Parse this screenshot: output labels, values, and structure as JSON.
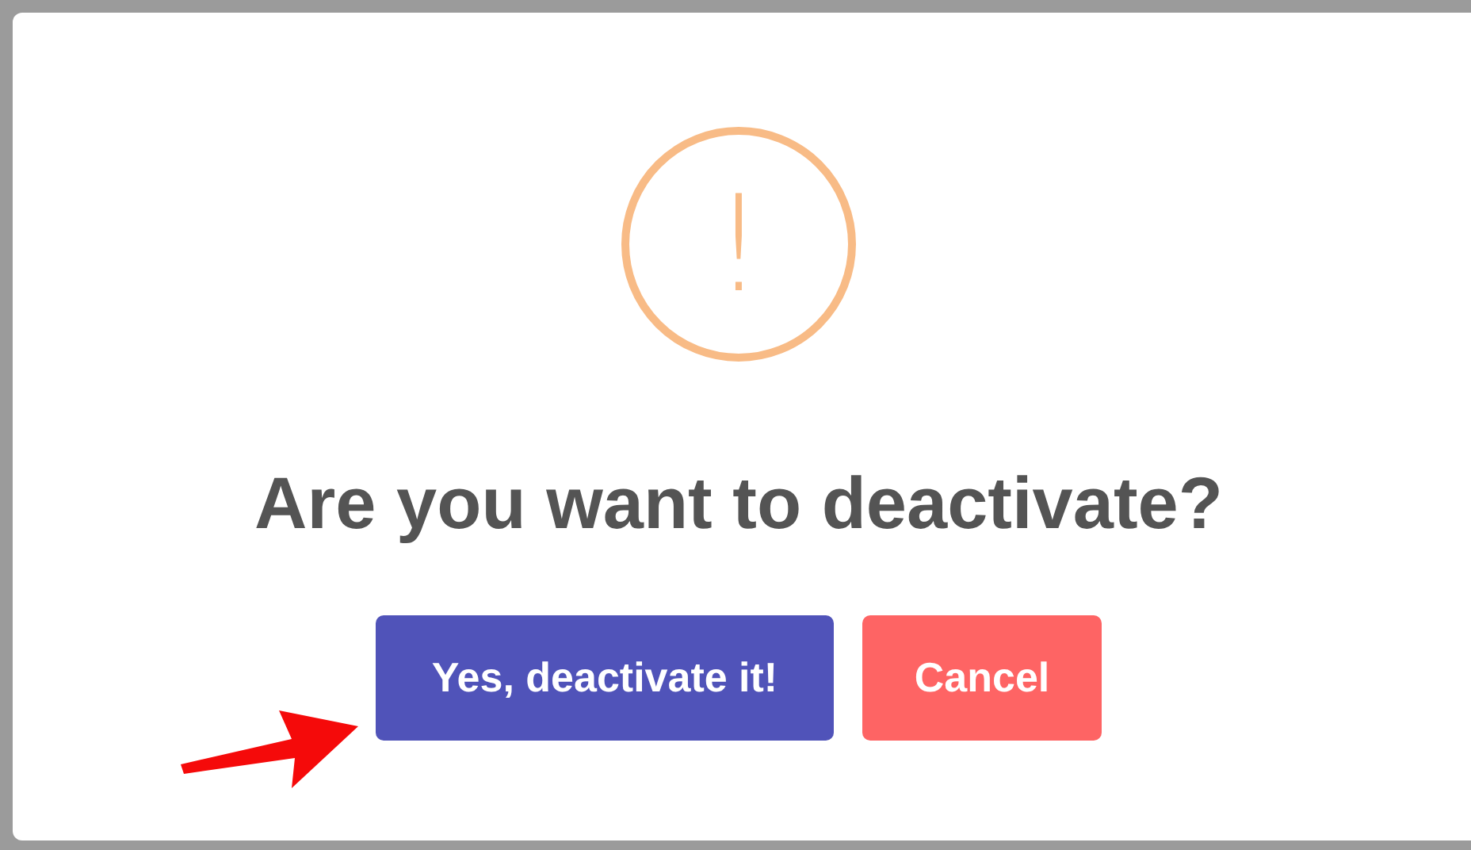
{
  "dialog": {
    "icon": "!",
    "title": "Are you want to deactivate?",
    "buttons": [
      {
        "label": "Yes, deactivate it!",
        "kind": "confirm"
      },
      {
        "label": "Cancel",
        "kind": "cancel"
      }
    ]
  }
}
